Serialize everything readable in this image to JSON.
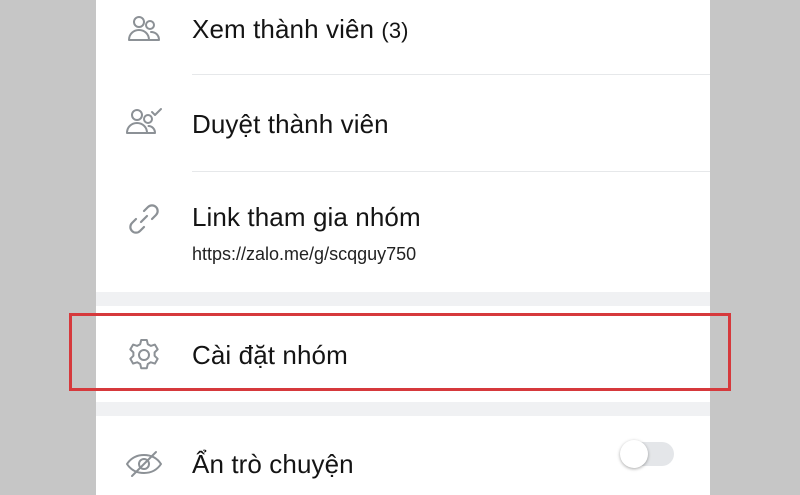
{
  "menu": {
    "view_members": {
      "label": "Xem thành viên",
      "count": "(3)",
      "icon": "members-icon"
    },
    "approve_members": {
      "label": "Duyệt thành viên",
      "icon": "members-check-icon"
    },
    "join_link": {
      "label": "Link tham gia nhóm",
      "url": "https://zalo.me/g/scqguy750",
      "icon": "link-icon"
    },
    "group_settings": {
      "label": "Cài đặt nhóm",
      "icon": "gear-icon"
    },
    "hide_chat": {
      "label": "Ẩn trò chuyện",
      "icon": "eye-off-icon",
      "toggle_on": false
    }
  },
  "colors": {
    "highlight": "#d6393c",
    "icon": "#8c9196",
    "background": "#c6c6c6"
  }
}
